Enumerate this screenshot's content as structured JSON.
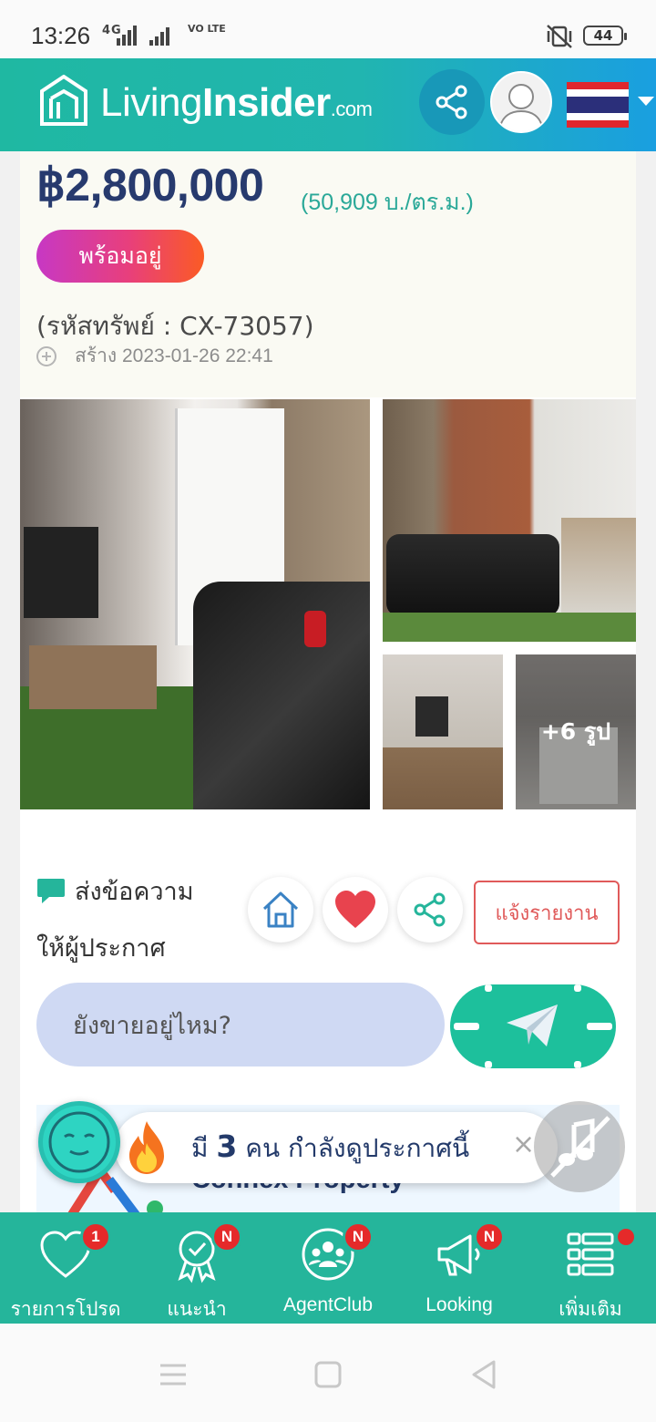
{
  "status_bar": {
    "time": "13:26",
    "network": "4G",
    "volte": "VO LTE",
    "battery": "44"
  },
  "header": {
    "brand_light": "Living",
    "brand_bold": "Insider",
    "brand_domain": ".com",
    "icons": [
      "share-icon",
      "user-avatar",
      "thailand-flag",
      "chevron-down-icon"
    ]
  },
  "listing": {
    "price": "฿2,800,000",
    "price_per_sqm": "(50,909 บ./ตร.ม.)",
    "status_badge": "พร้อมอยู่",
    "asset_code": "(รหัสทรัพย์ : CX-73057)",
    "created": "สร้าง 2023-01-26 22:41",
    "more_photos": "+6 รูป"
  },
  "message": {
    "title_line1": "ส่งข้อความ",
    "title_line2": "ให้ผู้ประกาศ",
    "input_value": "ยังขายอยู่ไหม?",
    "report_label": "แจ้งรายงาน",
    "action_icons": [
      "home-icon",
      "heart-icon",
      "share-icon"
    ]
  },
  "agent": {
    "name": "Connex Property"
  },
  "viewer_toast": {
    "prefix": "มี",
    "count": "3",
    "suffix": "คน กำลังดูประกาศนี้",
    "close": "×"
  },
  "bottom_nav": {
    "items": [
      {
        "label": "รายการโปรด",
        "badge": "1",
        "icon": "heart-icon"
      },
      {
        "label": "แนะนำ",
        "badge": "N",
        "icon": "award-icon"
      },
      {
        "label": "AgentClub",
        "badge": "N",
        "icon": "group-icon"
      },
      {
        "label": "Looking",
        "badge": "N",
        "icon": "megaphone-icon"
      },
      {
        "label": "เพิ่มเติม",
        "badge": "",
        "icon": "menu-list-icon"
      }
    ]
  },
  "colors": {
    "brand_teal": "#25b59b",
    "price_navy": "#273a6e",
    "badge_red": "#e52a2a",
    "report_red": "#e05a5a"
  }
}
